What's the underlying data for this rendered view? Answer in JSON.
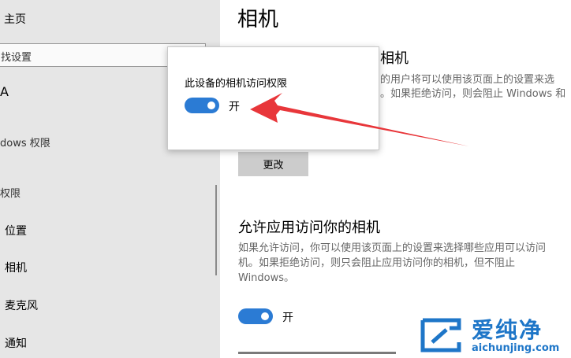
{
  "sidebar": {
    "home_label": "主页",
    "search_placeholder": "找设置",
    "partial_heading": "A",
    "windows_permissions": "dows 权限",
    "app_permissions": "权限",
    "items": [
      {
        "label": "位置"
      },
      {
        "label": "相机"
      },
      {
        "label": "麦克风"
      },
      {
        "label": "通知"
      }
    ]
  },
  "main": {
    "page_title": "相机",
    "section1_title_fragment": "相机",
    "section1_desc_line1": "的用户将可以使用该页面上的设置来选",
    "section1_desc_line2": "。如果拒绝访问，则会阻止 Windows 和",
    "change_button": "更改",
    "section2_title": "允许应用访问你的相机",
    "section2_desc_line1": "如果允许访问，你可以使用该页面上的设置来选择哪些应用可以访问",
    "section2_desc_line2": "机。如果拒绝访问，则只会阻止应用访问你的相机，但不阻止",
    "section2_desc_line3": "Windows。",
    "section2_toggle_label": "开"
  },
  "popup": {
    "title": "此设备的相机访问权限",
    "toggle_label": "开"
  },
  "watermark": {
    "name": "爱纯净",
    "url": "aichunjing.com"
  },
  "colors": {
    "accent": "#2b7bd4",
    "arrow": "#e8363a",
    "watermark": "#1e76c8"
  }
}
